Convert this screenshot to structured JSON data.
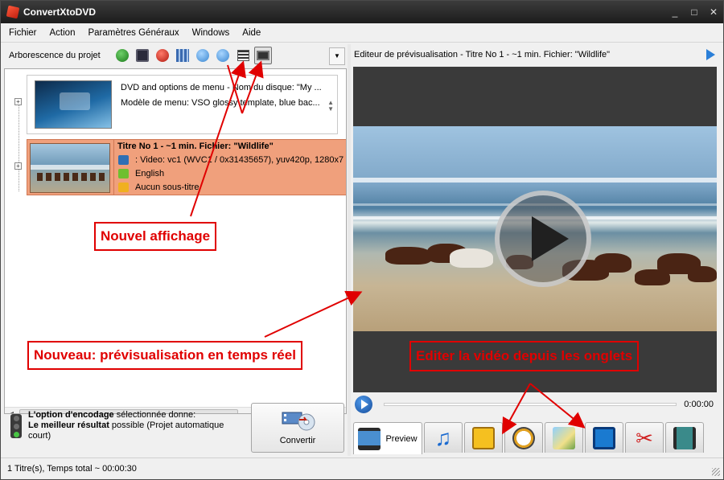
{
  "window": {
    "title": "ConvertXtoDVD",
    "controls": [
      "_",
      "□",
      "✕"
    ]
  },
  "menu": [
    "Fichier",
    "Action",
    "Paramètres Généraux",
    "Windows",
    "Aide"
  ],
  "left": {
    "toolbar_label": "Arborescence du projet",
    "menu_node": {
      "line1": "DVD and options de menu - Nom du disque: \"My ...",
      "line2": "Modèle de menu: VSO glossy template, blue bac..."
    },
    "title_node": {
      "title": "Titre No 1 - ~1 min. Fichier: \"Wildlife\"",
      "video": ": Video: vc1 (WVC1 / 0x31435657), yuv420p, 1280x7",
      "audio": "English",
      "subtitle": "Aucun sous-titre"
    },
    "encode": {
      "bold1": "L'option d'encodage",
      "text1": " sélectionnée donne:",
      "bold2": "Le meilleur résultat",
      "text2": " possible (Projet automatique court)"
    },
    "convert_label": "Convertir"
  },
  "right": {
    "header": "Editeur de prévisualisation - Titre No 1 - ~1 min. Fichier: \"Wildlife\"",
    "time": "0:00:00",
    "tabs": [
      {
        "icon": "film-preview-icon",
        "label": "Preview"
      },
      {
        "icon": "music-note-icon",
        "label": ""
      },
      {
        "icon": "subtitle-icon",
        "label": ""
      },
      {
        "icon": "stopwatch-icon",
        "label": ""
      },
      {
        "icon": "image-effects-icon",
        "label": ""
      },
      {
        "icon": "crop-icon",
        "label": ""
      },
      {
        "icon": "scissors-icon",
        "label": ""
      },
      {
        "icon": "film-merge-icon",
        "label": ""
      }
    ]
  },
  "status": "1 Titre(s), Temps total ~ 00:00:30",
  "annotations": {
    "nouvel_affichage": "Nouvel affichage",
    "previsualisation": "Nouveau: prévisualisation en temps réel",
    "editer": "Editer la vidéo depuis les onglets"
  },
  "colors": {
    "accent_red": "#e00000",
    "title_node_bg": "#f0a07c",
    "titlebar": "#2a2a2a"
  }
}
